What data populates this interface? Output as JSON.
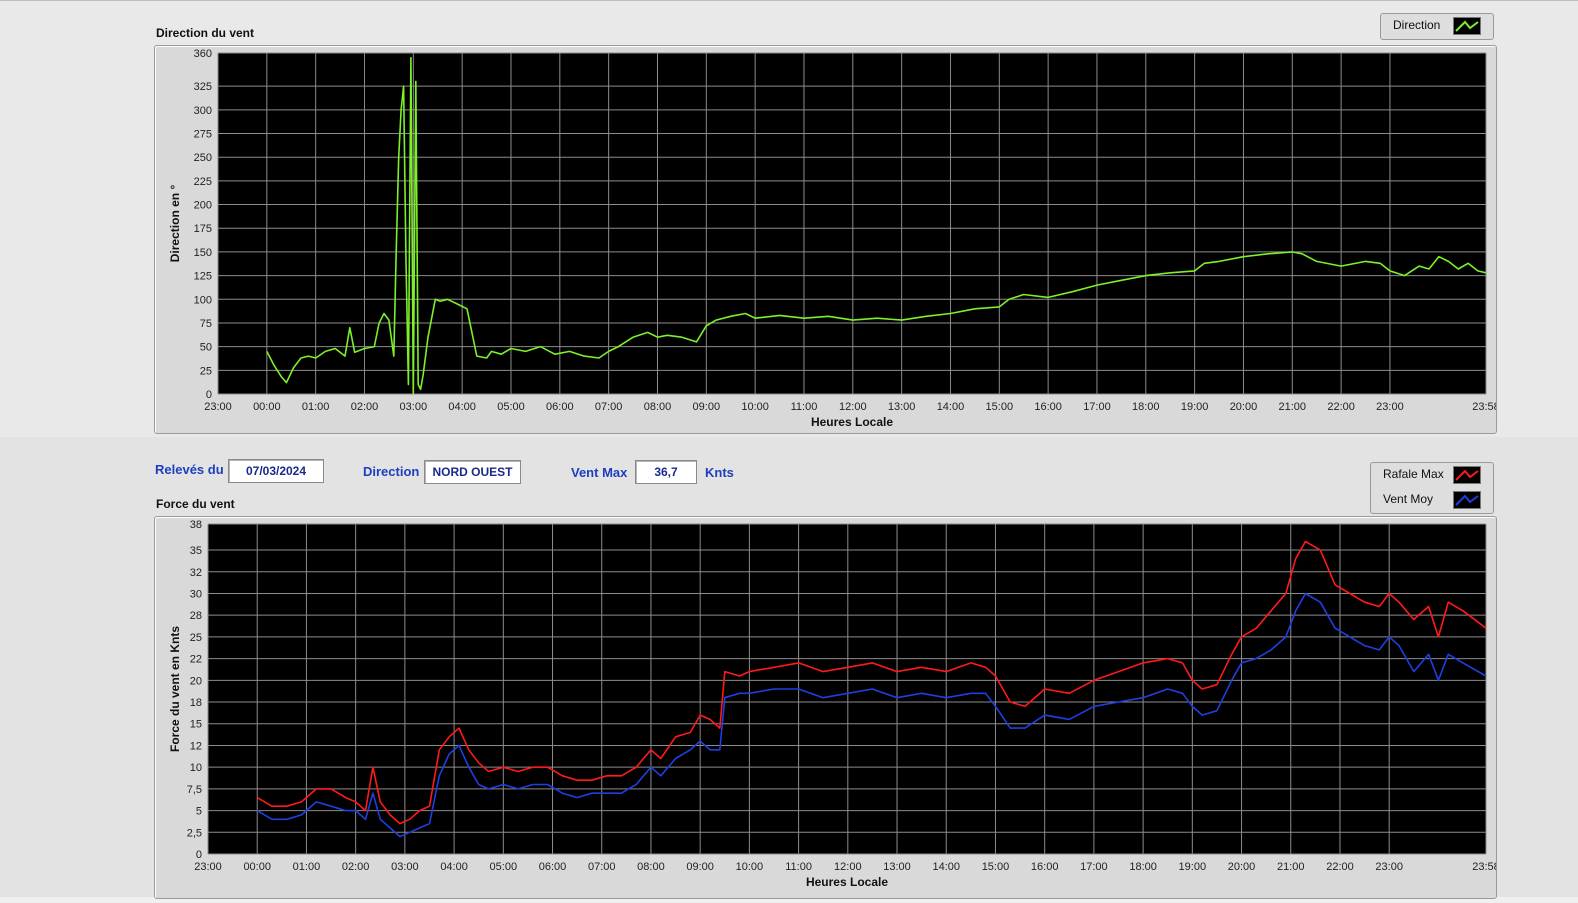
{
  "controls": {
    "releves_label": "Relevés du",
    "date": "07/03/2024",
    "direction_label": "Direction",
    "direction_value": "NORD OUEST",
    "ventmax_label": "Vent Max",
    "ventmax_value": "36,7",
    "unit": "Knts"
  },
  "colors": {
    "direction": "#7df02a",
    "rafale": "#ff1a1a",
    "vent_moy": "#1f3fe0",
    "plot_bg": "#000000",
    "grid": "#8c8c8c"
  },
  "chart_data": [
    {
      "type": "line",
      "title": "Direction du vent",
      "xlabel": "Heures Locale",
      "ylabel": "Direction en °",
      "ylim": [
        0,
        360
      ],
      "yticks": [
        0,
        25,
        50,
        75,
        100,
        125,
        150,
        175,
        200,
        225,
        250,
        275,
        300,
        325,
        360
      ],
      "ytick_labels": [
        "0",
        "25",
        "50",
        "75",
        "100",
        "125",
        "150",
        "175",
        "200",
        "225",
        "250",
        "275",
        "300",
        "325",
        "360"
      ],
      "xlim": [
        -1,
        24.967
      ],
      "xticks": [
        -1,
        0,
        1,
        2,
        3,
        4,
        5,
        6,
        7,
        8,
        9,
        10,
        11,
        12,
        13,
        14,
        15,
        16,
        17,
        18,
        19,
        20,
        21,
        22,
        23,
        24.967
      ],
      "xtick_labels": [
        "23:00",
        "00:00",
        "01:00",
        "02:00",
        "03:00",
        "04:00",
        "05:00",
        "06:00",
        "07:00",
        "08:00",
        "09:00",
        "10:00",
        "11:00",
        "12:00",
        "13:00",
        "14:00",
        "15:00",
        "16:00",
        "17:00",
        "18:00",
        "19:00",
        "20:00",
        "21:00",
        "22:00",
        "23:00",
        "23:58"
      ],
      "grid": true,
      "legend": "top-right",
      "series": [
        {
          "name": "Direction",
          "x": [
            0.0,
            0.15,
            0.3,
            0.4,
            0.55,
            0.7,
            0.85,
            1.0,
            1.2,
            1.4,
            1.6,
            1.7,
            1.8,
            2.0,
            2.2,
            2.3,
            2.4,
            2.5,
            2.6,
            2.65,
            2.7,
            2.75,
            2.8,
            2.85,
            2.9,
            2.95,
            3.0,
            3.05,
            3.1,
            3.15,
            3.2,
            3.3,
            3.45,
            3.55,
            3.7,
            3.9,
            4.1,
            4.3,
            4.5,
            4.6,
            4.8,
            5.0,
            5.3,
            5.6,
            5.9,
            6.2,
            6.5,
            6.8,
            7.0,
            7.2,
            7.5,
            7.8,
            8.0,
            8.2,
            8.5,
            8.8,
            9.0,
            9.2,
            9.5,
            9.8,
            10.0,
            10.5,
            11.0,
            11.5,
            12.0,
            12.5,
            13.0,
            13.5,
            14.0,
            14.5,
            15.0,
            15.2,
            15.5,
            16.0,
            16.5,
            17.0,
            17.5,
            18.0,
            18.5,
            19.0,
            19.2,
            19.5,
            20.0,
            20.5,
            21.0,
            21.2,
            21.5,
            22.0,
            22.5,
            22.8,
            23.0,
            23.3,
            23.6,
            23.8,
            24.0,
            24.2,
            24.4,
            24.6,
            24.8,
            24.967
          ],
          "y": [
            45,
            30,
            18,
            12,
            28,
            38,
            40,
            38,
            45,
            48,
            40,
            70,
            44,
            48,
            50,
            75,
            85,
            78,
            40,
            150,
            250,
            300,
            325,
            140,
            10,
            355,
            0,
            330,
            10,
            5,
            20,
            60,
            100,
            98,
            100,
            95,
            90,
            40,
            38,
            45,
            42,
            48,
            45,
            50,
            42,
            45,
            40,
            38,
            45,
            50,
            60,
            65,
            60,
            62,
            60,
            55,
            72,
            78,
            82,
            85,
            80,
            83,
            80,
            82,
            78,
            80,
            78,
            82,
            85,
            90,
            92,
            100,
            105,
            102,
            108,
            115,
            120,
            125,
            128,
            130,
            138,
            140,
            145,
            148,
            150,
            148,
            140,
            135,
            140,
            138,
            130,
            125,
            135,
            132,
            145,
            140,
            132,
            138,
            130,
            128
          ]
        }
      ]
    },
    {
      "type": "line",
      "title": "Force du vent",
      "xlabel": "Heures Locale",
      "ylabel": "Force du vent en Knts",
      "ylim": [
        0,
        38
      ],
      "yticks": [
        0,
        2.5,
        5,
        7.5,
        10,
        12.5,
        15,
        17.5,
        20,
        22.5,
        25,
        27.5,
        30,
        32.5,
        35,
        38
      ],
      "ytick_labels": [
        "0",
        "2,5",
        "5",
        "7,5",
        "10",
        "12",
        "15",
        "18",
        "20",
        "22",
        "25",
        "28",
        "30",
        "32",
        "35",
        "38"
      ],
      "xlim": [
        -1,
        24.967
      ],
      "xticks": [
        -1,
        0,
        1,
        2,
        3,
        4,
        5,
        6,
        7,
        8,
        9,
        10,
        11,
        12,
        13,
        14,
        15,
        16,
        17,
        18,
        19,
        20,
        21,
        22,
        23,
        24.967
      ],
      "xtick_labels": [
        "23:00",
        "00:00",
        "01:00",
        "02:00",
        "03:00",
        "04:00",
        "05:00",
        "06:00",
        "07:00",
        "08:00",
        "09:00",
        "10:00",
        "11:00",
        "12:00",
        "13:00",
        "14:00",
        "15:00",
        "16:00",
        "17:00",
        "18:00",
        "19:00",
        "20:00",
        "21:00",
        "22:00",
        "23:00",
        "23:58"
      ],
      "grid": true,
      "legend": "top-right",
      "series": [
        {
          "name": "Rafale Max",
          "x": [
            0.0,
            0.3,
            0.6,
            0.9,
            1.2,
            1.5,
            1.8,
            2.0,
            2.2,
            2.35,
            2.5,
            2.7,
            2.9,
            3.1,
            3.3,
            3.5,
            3.7,
            3.9,
            4.1,
            4.3,
            4.5,
            4.7,
            5.0,
            5.3,
            5.6,
            5.9,
            6.2,
            6.5,
            6.8,
            7.1,
            7.4,
            7.7,
            8.0,
            8.2,
            8.5,
            8.8,
            9.0,
            9.2,
            9.4,
            9.5,
            9.8,
            10.0,
            10.5,
            11.0,
            11.5,
            12.0,
            12.5,
            13.0,
            13.5,
            14.0,
            14.5,
            14.8,
            15.0,
            15.3,
            15.6,
            16.0,
            16.5,
            17.0,
            17.5,
            18.0,
            18.5,
            18.8,
            19.0,
            19.2,
            19.5,
            19.8,
            20.0,
            20.3,
            20.6,
            20.9,
            21.1,
            21.3,
            21.6,
            21.9,
            22.2,
            22.5,
            22.8,
            23.0,
            23.2,
            23.5,
            23.8,
            24.0,
            24.2,
            24.5,
            24.967
          ],
          "y": [
            6.5,
            5.5,
            5.5,
            6.0,
            7.5,
            7.5,
            6.5,
            6.0,
            5.0,
            10.0,
            6.0,
            4.5,
            3.5,
            4.0,
            5.0,
            5.5,
            12.0,
            13.5,
            14.5,
            12.0,
            10.5,
            9.5,
            10.0,
            9.5,
            10.0,
            10.0,
            9.0,
            8.5,
            8.5,
            9.0,
            9.0,
            10.0,
            12.0,
            11.0,
            13.5,
            14.0,
            16.0,
            15.5,
            14.5,
            21.0,
            20.5,
            21.0,
            21.5,
            22.0,
            21.0,
            21.5,
            22.0,
            21.0,
            21.5,
            21.0,
            22.0,
            21.5,
            20.5,
            17.5,
            17.0,
            19.0,
            18.5,
            20.0,
            21.0,
            22.0,
            22.5,
            22.0,
            20.0,
            19.0,
            19.5,
            23.0,
            25.0,
            26.0,
            28.0,
            30.0,
            34.0,
            36.0,
            35.0,
            31.0,
            30.0,
            29.0,
            28.5,
            30.0,
            29.0,
            27.0,
            28.5,
            25.0,
            29.0,
            28.0,
            26.0
          ]
        },
        {
          "name": "Vent Moy",
          "x": [
            0.0,
            0.3,
            0.6,
            0.9,
            1.2,
            1.5,
            1.8,
            2.0,
            2.2,
            2.35,
            2.5,
            2.7,
            2.9,
            3.1,
            3.3,
            3.5,
            3.7,
            3.9,
            4.1,
            4.3,
            4.5,
            4.7,
            5.0,
            5.3,
            5.6,
            5.9,
            6.2,
            6.5,
            6.8,
            7.1,
            7.4,
            7.7,
            8.0,
            8.2,
            8.5,
            8.8,
            9.0,
            9.2,
            9.4,
            9.5,
            9.8,
            10.0,
            10.5,
            11.0,
            11.5,
            12.0,
            12.5,
            13.0,
            13.5,
            14.0,
            14.5,
            14.8,
            15.0,
            15.3,
            15.6,
            16.0,
            16.5,
            17.0,
            17.5,
            18.0,
            18.5,
            18.8,
            19.0,
            19.2,
            19.5,
            19.8,
            20.0,
            20.3,
            20.6,
            20.9,
            21.1,
            21.3,
            21.6,
            21.9,
            22.2,
            22.5,
            22.8,
            23.0,
            23.2,
            23.5,
            23.8,
            24.0,
            24.2,
            24.5,
            24.967
          ],
          "y": [
            5.0,
            4.0,
            4.0,
            4.5,
            6.0,
            5.5,
            5.0,
            5.0,
            4.0,
            7.0,
            4.0,
            3.0,
            2.0,
            2.5,
            3.0,
            3.5,
            9.0,
            11.5,
            12.5,
            10.0,
            8.0,
            7.5,
            8.0,
            7.5,
            8.0,
            8.0,
            7.0,
            6.5,
            7.0,
            7.0,
            7.0,
            8.0,
            10.0,
            9.0,
            11.0,
            12.0,
            13.0,
            12.0,
            12.0,
            18.0,
            18.5,
            18.5,
            19.0,
            19.0,
            18.0,
            18.5,
            19.0,
            18.0,
            18.5,
            18.0,
            18.5,
            18.5,
            17.0,
            14.5,
            14.5,
            16.0,
            15.5,
            17.0,
            17.5,
            18.0,
            19.0,
            18.5,
            17.0,
            16.0,
            16.5,
            20.0,
            22.0,
            22.5,
            23.5,
            25.0,
            28.0,
            30.0,
            29.0,
            26.0,
            25.0,
            24.0,
            23.5,
            25.0,
            24.0,
            21.0,
            23.0,
            20.0,
            23.0,
            22.0,
            20.5
          ]
        }
      ]
    }
  ]
}
